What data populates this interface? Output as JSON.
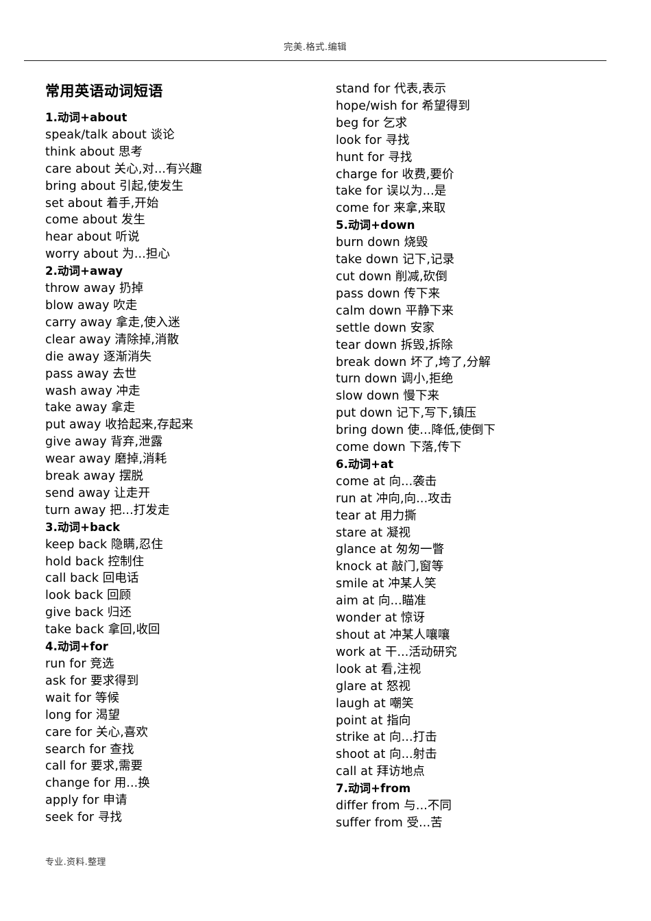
{
  "header": {
    "text": "完美.格式.编辑"
  },
  "footer": {
    "text": "专业.资料.整理"
  },
  "document": {
    "title": "常用英语动词短语"
  },
  "left_column": [
    {
      "type": "section",
      "text": "1.动词+about"
    },
    {
      "type": "item",
      "text": "speak/talk about 谈论"
    },
    {
      "type": "item",
      "text": "think about 思考"
    },
    {
      "type": "item",
      "text": "care about 关心,对...有兴趣"
    },
    {
      "type": "item",
      "text": "bring about 引起,使发生"
    },
    {
      "type": "item",
      "text": "set about 着手,开始"
    },
    {
      "type": "item",
      "text": "come about 发生"
    },
    {
      "type": "item",
      "text": "hear about 听说"
    },
    {
      "type": "item",
      "text": "worry about 为...担心"
    },
    {
      "type": "section",
      "text": "2.动词+away"
    },
    {
      "type": "item",
      "text": "throw away 扔掉"
    },
    {
      "type": "item",
      "text": "blow away 吹走"
    },
    {
      "type": "item",
      "text": "carry away 拿走,使入迷"
    },
    {
      "type": "item",
      "text": "clear away 清除掉,消散"
    },
    {
      "type": "item",
      "text": "die away 逐渐消失"
    },
    {
      "type": "item",
      "text": "pass away 去世"
    },
    {
      "type": "item",
      "text": "wash away 冲走"
    },
    {
      "type": "item",
      "text": "take away 拿走"
    },
    {
      "type": "item",
      "text": "put away 收拾起来,存起来"
    },
    {
      "type": "item",
      "text": "give away 背弃,泄露"
    },
    {
      "type": "item",
      "text": "wear away 磨掉,消耗"
    },
    {
      "type": "item",
      "text": "break away 摆脱"
    },
    {
      "type": "item",
      "text": "send away 让走开"
    },
    {
      "type": "item",
      "text": "turn away 把...打发走"
    },
    {
      "type": "section",
      "text": "3.动词+back"
    },
    {
      "type": "item",
      "text": "keep back 隐瞒,忍住"
    },
    {
      "type": "item",
      "text": "hold back 控制住"
    },
    {
      "type": "item",
      "text": "call back 回电话"
    },
    {
      "type": "item",
      "text": "look back 回顾"
    },
    {
      "type": "item",
      "text": "give back 归还"
    },
    {
      "type": "item",
      "text": "take back 拿回,收回"
    },
    {
      "type": "section",
      "text": "4.动词+for"
    },
    {
      "type": "item",
      "text": "run for 竞选"
    },
    {
      "type": "item",
      "text": "ask for 要求得到"
    },
    {
      "type": "item",
      "text": "wait for 等候"
    },
    {
      "type": "item",
      "text": "long for 渴望"
    },
    {
      "type": "item",
      "text": "care for 关心,喜欢"
    },
    {
      "type": "item",
      "text": "search for 查找"
    },
    {
      "type": "item",
      "text": "call for 要求,需要"
    },
    {
      "type": "item",
      "text": "change for 用...换"
    },
    {
      "type": "item",
      "text": "apply for 申请"
    },
    {
      "type": "item",
      "text": "seek for 寻找"
    }
  ],
  "right_column": [
    {
      "type": "item",
      "text": "stand for 代表,表示"
    },
    {
      "type": "item",
      "text": "hope/wish for 希望得到"
    },
    {
      "type": "item",
      "text": "beg for 乞求"
    },
    {
      "type": "item",
      "text": "look for 寻找"
    },
    {
      "type": "item",
      "text": "hunt for 寻找"
    },
    {
      "type": "item",
      "text": "charge for 收费,要价"
    },
    {
      "type": "item",
      "text": "take for 误以为...是"
    },
    {
      "type": "item",
      "text": "come for 来拿,来取"
    },
    {
      "type": "section",
      "text": "5.动词+down"
    },
    {
      "type": "item",
      "text": "burn down 烧毁"
    },
    {
      "type": "item",
      "text": "take down 记下,记录"
    },
    {
      "type": "item",
      "text": "cut down 削减,砍倒"
    },
    {
      "type": "item",
      "text": "pass down 传下来"
    },
    {
      "type": "item",
      "text": "calm down 平静下来"
    },
    {
      "type": "item",
      "text": "settle down 安家"
    },
    {
      "type": "item",
      "text": "tear down 拆毁,拆除"
    },
    {
      "type": "item",
      "text": "break down 坏了,垮了,分解"
    },
    {
      "type": "item",
      "text": "turn down 调小,拒绝"
    },
    {
      "type": "item",
      "text": "slow down 慢下来"
    },
    {
      "type": "item",
      "text": "put down 记下,写下,镇压"
    },
    {
      "type": "item",
      "text": "bring down 使...降低,使倒下"
    },
    {
      "type": "item",
      "text": "come down 下落,传下"
    },
    {
      "type": "section",
      "text": "6.动词+at"
    },
    {
      "type": "item",
      "text": "come at 向...袭击"
    },
    {
      "type": "item",
      "text": "run at 冲向,向...攻击"
    },
    {
      "type": "item",
      "text": "tear at 用力撕"
    },
    {
      "type": "item",
      "text": "stare at 凝视"
    },
    {
      "type": "item",
      "text": "glance at 匆匆一瞥"
    },
    {
      "type": "item",
      "text": "knock at 敲门,窗等"
    },
    {
      "type": "item",
      "text": "smile at 冲某人笑"
    },
    {
      "type": "item",
      "text": "aim at 向...瞄准"
    },
    {
      "type": "item",
      "text": "wonder at 惊讶"
    },
    {
      "type": "item",
      "text": "shout at 冲某人嚷嚷"
    },
    {
      "type": "item",
      "text": "work at 干...活动研究"
    },
    {
      "type": "item",
      "text": "look at 看,注视"
    },
    {
      "type": "item",
      "text": "glare at 怒视"
    },
    {
      "type": "item",
      "text": "laugh at 嘲笑"
    },
    {
      "type": "item",
      "text": "point at 指向"
    },
    {
      "type": "item",
      "text": "strike at 向...打击"
    },
    {
      "type": "item",
      "text": "shoot at 向...射击"
    },
    {
      "type": "item",
      "text": "call at 拜访地点"
    },
    {
      "type": "section",
      "text": "7.动词+from"
    },
    {
      "type": "item",
      "text": "differ from 与...不同"
    },
    {
      "type": "item",
      "text": "suffer from 受...苦"
    }
  ],
  "colors": {
    "text": "#000000",
    "header_footer_text": "#3a3a3a",
    "rule": "#1a1a1a",
    "page_background": "#ffffff"
  }
}
